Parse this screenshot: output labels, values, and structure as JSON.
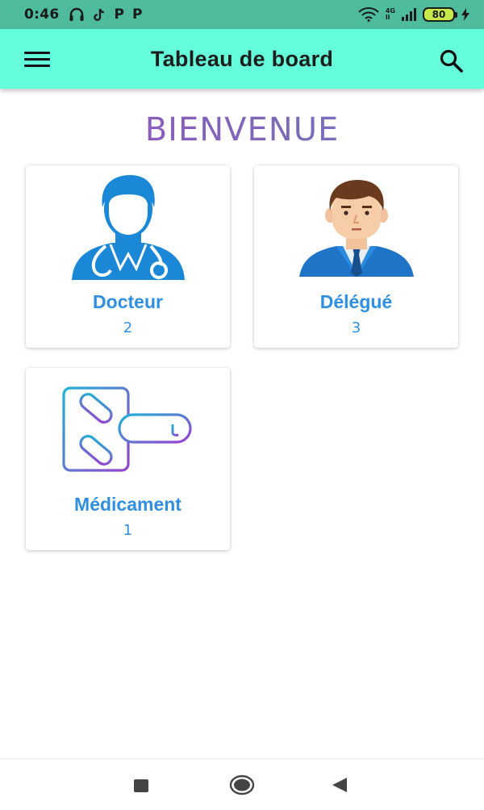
{
  "status_bar": {
    "time": "0:46",
    "left_icons": [
      "headphones-icon",
      "tiktok-icon",
      "p-icon",
      "p-icon"
    ],
    "network_label_top": "4G",
    "network_label_bottom": "ll",
    "battery_level": "80",
    "right_icons": [
      "wifi-icon",
      "signal-icon",
      "battery-icon",
      "charging-icon"
    ]
  },
  "app_bar": {
    "title": "Tableau de board",
    "menu_icon": "menu-icon",
    "search_icon": "search-icon",
    "background": "#64ffda"
  },
  "main": {
    "welcome": "BIENVENUE",
    "cards": [
      {
        "label": "Docteur",
        "count": "2",
        "icon": "doctor-icon"
      },
      {
        "label": "Délégué",
        "count": "3",
        "icon": "delegate-icon"
      },
      {
        "label": "Médicament",
        "count": "1",
        "icon": "medication-icon"
      }
    ]
  },
  "nav_bar": {
    "buttons": [
      "recents-icon",
      "home-icon",
      "back-icon"
    ]
  },
  "colors": {
    "status_bar": "#4dbb9c",
    "accent_blue": "#2f8fe0",
    "welcome_purple": "#9a4fc4"
  }
}
